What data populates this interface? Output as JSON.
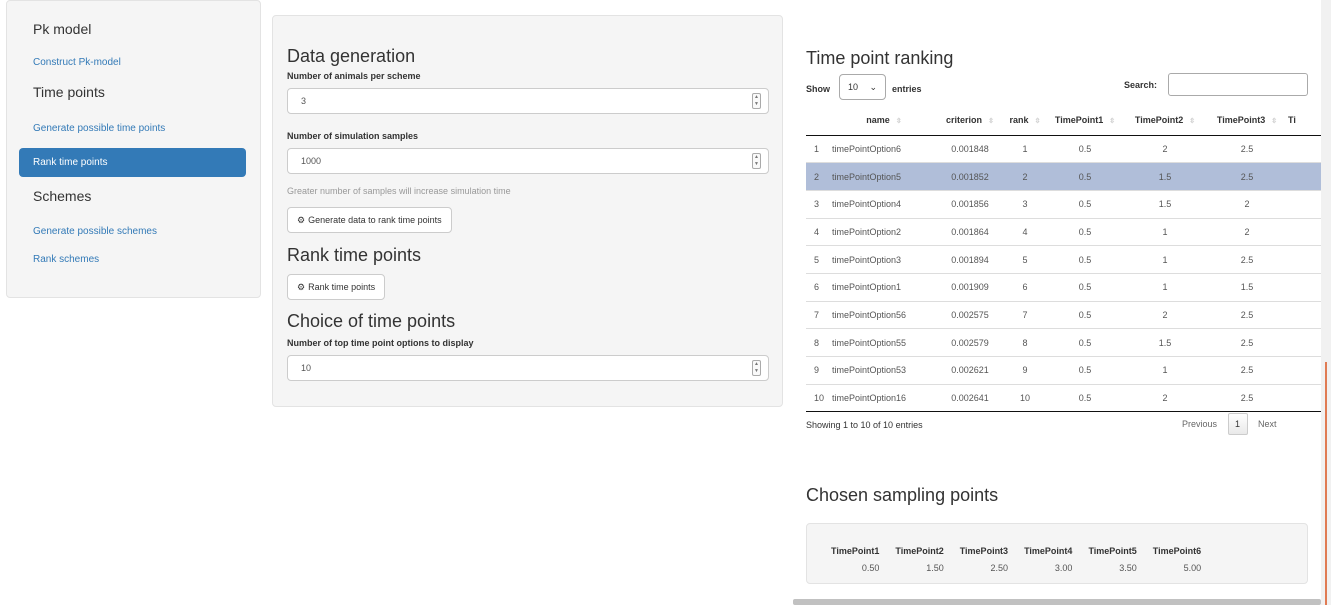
{
  "sidebar": {
    "sections": [
      {
        "heading": "Pk model",
        "links": [
          "Construct Pk-model"
        ]
      },
      {
        "heading": "Time points",
        "links": [
          "Generate possible time points",
          "Rank time points"
        ]
      },
      {
        "heading": "Schemes",
        "links": [
          "Generate possible schemes",
          "Rank schemes"
        ]
      }
    ],
    "active_link": "Rank time points"
  },
  "data_generation": {
    "title": "Data generation",
    "animals_label": "Number of animals per scheme",
    "animals_value": "3",
    "samples_label": "Number of simulation samples",
    "samples_value": "1000",
    "help_text": "Greater number of samples will increase simulation time",
    "generate_button": "Generate data to rank time points"
  },
  "rank_time_points": {
    "title": "Rank time points",
    "button": "Rank time points"
  },
  "choice": {
    "title": "Choice of time points",
    "label": "Number of top time point options to display",
    "value": "10"
  },
  "ranking": {
    "title": "Time point ranking",
    "show_label": "Show",
    "entries_value": "10",
    "entries_label": "entries",
    "search_label": "Search:",
    "columns": [
      "",
      "name",
      "criterion",
      "rank",
      "TimePoint1",
      "TimePoint2",
      "TimePoint3",
      "Ti"
    ],
    "rows": [
      [
        "1",
        "timePointOption6",
        "0.001848",
        "1",
        "0.5",
        "2",
        "2.5"
      ],
      [
        "2",
        "timePointOption5",
        "0.001852",
        "2",
        "0.5",
        "1.5",
        "2.5"
      ],
      [
        "3",
        "timePointOption4",
        "0.001856",
        "3",
        "0.5",
        "1.5",
        "2"
      ],
      [
        "4",
        "timePointOption2",
        "0.001864",
        "4",
        "0.5",
        "1",
        "2"
      ],
      [
        "5",
        "timePointOption3",
        "0.001894",
        "5",
        "0.5",
        "1",
        "2.5"
      ],
      [
        "6",
        "timePointOption1",
        "0.001909",
        "6",
        "0.5",
        "1",
        "1.5"
      ],
      [
        "7",
        "timePointOption56",
        "0.002575",
        "7",
        "0.5",
        "2",
        "2.5"
      ],
      [
        "8",
        "timePointOption55",
        "0.002579",
        "8",
        "0.5",
        "1.5",
        "2.5"
      ],
      [
        "9",
        "timePointOption53",
        "0.002621",
        "9",
        "0.5",
        "1",
        "2.5"
      ],
      [
        "10",
        "timePointOption16",
        "0.002641",
        "10",
        "0.5",
        "2",
        "2.5"
      ]
    ],
    "selected_row": 2,
    "info": "Showing 1 to 10 of 10 entries",
    "previous": "Previous",
    "page": "1",
    "next": "Next"
  },
  "chosen": {
    "title": "Chosen sampling points",
    "columns": [
      "TimePoint1",
      "TimePoint2",
      "TimePoint3",
      "TimePoint4",
      "TimePoint5",
      "TimePoint6"
    ],
    "values": [
      "0.50",
      "1.50",
      "2.50",
      "3.00",
      "3.50",
      "5.00"
    ]
  },
  "icons": {
    "gear": "gears-icon",
    "sort": "sort-icon",
    "chevron": "chevron-down-icon"
  },
  "colors": {
    "accent": "#337ab7",
    "selected_row": "#b0bed9",
    "scroll_indicator": "#e07b53"
  }
}
